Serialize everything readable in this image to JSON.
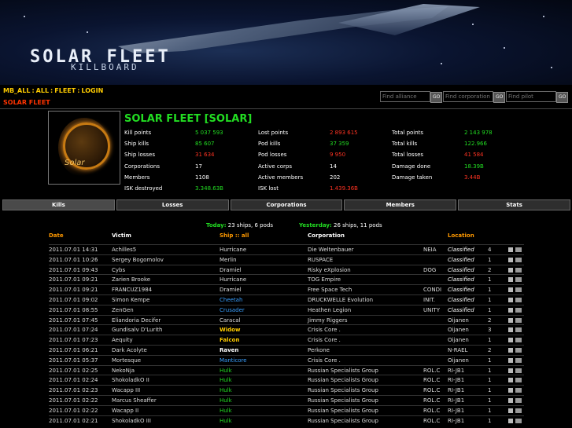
{
  "banner": {
    "title": "SOLAR FLEET",
    "subtitle": "KILLBOARD"
  },
  "nav": {
    "crumbs": [
      "MB_ALL",
      "ALL",
      "FLEET",
      "LOGIN"
    ],
    "current": "SOLAR FLEET",
    "search": [
      {
        "placeholder": "Find alliance",
        "button": "GO"
      },
      {
        "placeholder": "Find corporation",
        "button": "GO"
      },
      {
        "placeholder": "Find pilot",
        "button": "GO"
      }
    ]
  },
  "corp": {
    "emblem_text": "Solar",
    "name": "SOLAR FLEET [SOLAR]",
    "stats_col1": [
      {
        "label": "Kill points",
        "value": "5 037 593",
        "color": "green"
      },
      {
        "label": "Ship kills",
        "value": "85 607",
        "color": "green"
      },
      {
        "label": "Ship losses",
        "value": "31 634",
        "color": "red"
      },
      {
        "label": "Corporations",
        "value": "17",
        "color": "white"
      },
      {
        "label": "Members",
        "value": "1108",
        "color": "white"
      },
      {
        "label": "ISK destroyed",
        "value": "3.348.63B",
        "color": "green"
      }
    ],
    "stats_col2": [
      {
        "label": "Lost points",
        "value": "2 893 615",
        "color": "red"
      },
      {
        "label": "Pod kills",
        "value": "37 359",
        "color": "green"
      },
      {
        "label": "Pod losses",
        "value": "9 950",
        "color": "red"
      },
      {
        "label": "Active corps",
        "value": "14",
        "color": "white"
      },
      {
        "label": "Active members",
        "value": "202",
        "color": "white"
      },
      {
        "label": "ISK lost",
        "value": "1.439.36B",
        "color": "red"
      }
    ],
    "stats_col3": [
      {
        "label": "Total points",
        "value": "2 143 978",
        "color": "green"
      },
      {
        "label": "Total kills",
        "value": "122.966",
        "color": "green"
      },
      {
        "label": "Total losses",
        "value": "41 584",
        "color": "red"
      },
      {
        "label": "Damage done",
        "value": "18.39B",
        "color": "green"
      },
      {
        "label": "Damage taken",
        "value": "3.44B",
        "color": "red"
      }
    ]
  },
  "tabs": [
    "Kills",
    "Losses",
    "Corporations",
    "Members",
    "Stats"
  ],
  "summary": {
    "today_label": "Today:",
    "today_value": "23 ships, 6 pods",
    "yesterday_label": "Yesterday:",
    "yesterday_value": "26 ships, 11 pods"
  },
  "table": {
    "headers": [
      "Date",
      "Victim",
      "Ship :: all",
      "Corporation",
      "Location"
    ],
    "rows": [
      {
        "date": "2011.07.01 14:31",
        "victim": "Achilles5",
        "ship": "Hurricane",
        "shipStyle": "",
        "corp": "Die Weltenbauer",
        "tick": "NEIA",
        "loc": "Classified",
        "sec": "4"
      },
      {
        "date": "2011.07.01 10:26",
        "victim": "Sergey Bogomolov",
        "ship": "Merlin",
        "shipStyle": "",
        "corp": "RUSPACE",
        "tick": "",
        "loc": "Classified",
        "sec": "1"
      },
      {
        "date": "2011.07.01 09:43",
        "victim": "Cybs",
        "ship": "Dramiel",
        "shipStyle": "",
        "corp": "Risky eXplosion",
        "tick": "DOG",
        "loc": "Classified",
        "sec": "2"
      },
      {
        "date": "2011.07.01 09:21",
        "victim": "Zarien Brooke",
        "ship": "Hurricane",
        "shipStyle": "",
        "corp": "TOG Empire",
        "tick": "",
        "loc": "Classified",
        "sec": "1"
      },
      {
        "date": "2011.07.01 09:21",
        "victim": "FRANCUZ1984",
        "ship": "Dramiel",
        "shipStyle": "",
        "corp": "Free Space Tech",
        "tick": "CONDI",
        "loc": "Classified",
        "sec": "1"
      },
      {
        "date": "2011.07.01 09:02",
        "victim": "Simon Kempe",
        "ship": "Cheetah",
        "shipStyle": "blue",
        "corp": "DRUCKWELLE Evolution",
        "tick": "INIT.",
        "loc": "Classified",
        "sec": "1"
      },
      {
        "date": "2011.07.01 08:55",
        "victim": "ZenGen",
        "ship": "Crusader",
        "shipStyle": "blue",
        "corp": "Heathen Legion",
        "tick": "UNITY",
        "loc": "Classified",
        "sec": "1"
      },
      {
        "date": "2011.07.01 07:45",
        "victim": "Eliandoria Decifer",
        "ship": "Caracal",
        "shipStyle": "",
        "corp": "Jimmy Riggers",
        "tick": "",
        "loc": "Oijanen",
        "sec": "2"
      },
      {
        "date": "2011.07.01 07:24",
        "victim": "Gundisalv D'Lurith",
        "ship": "Widow",
        "shipStyle": "yel",
        "corp": "Crisis Core .",
        "tick": "",
        "loc": "Oijanen",
        "sec": "3"
      },
      {
        "date": "2011.07.01 07:23",
        "victim": "Aequity",
        "ship": "Falcon",
        "shipStyle": "yel",
        "corp": "Crisis Core .",
        "tick": "",
        "loc": "Oijanen",
        "sec": "1"
      },
      {
        "date": "2011.07.01 06:21",
        "victim": "Dark Acolyte",
        "ship": "Raven",
        "shipStyle": "bold",
        "corp": "Perkone",
        "tick": "",
        "loc": "N-RAEL",
        "sec": "2"
      },
      {
        "date": "2011.07.01 05:37",
        "victim": "Mortesque",
        "ship": "Manticore",
        "shipStyle": "blue",
        "corp": "Crisis Core .",
        "tick": "",
        "loc": "Oijanen",
        "sec": "1"
      },
      {
        "date": "2011.07.01 02:25",
        "victim": "NekoNja",
        "ship": "Hulk",
        "shipStyle": "grn",
        "corp": "Russian Specialists Group",
        "tick": "ROL.C",
        "loc": "RI-JB1",
        "sec": "1"
      },
      {
        "date": "2011.07.01 02:24",
        "victim": "ShokoladkO II",
        "ship": "Hulk",
        "shipStyle": "grn",
        "corp": "Russian Specialists Group",
        "tick": "ROL.C",
        "loc": "RI-JB1",
        "sec": "1"
      },
      {
        "date": "2011.07.01 02:23",
        "victim": "Wacapp III",
        "ship": "Hulk",
        "shipStyle": "grn",
        "corp": "Russian Specialists Group",
        "tick": "ROL.C",
        "loc": "RI-JB1",
        "sec": "1"
      },
      {
        "date": "2011.07.01 02:22",
        "victim": "Marcus Sheaffer",
        "ship": "Hulk",
        "shipStyle": "grn",
        "corp": "Russian Specialists Group",
        "tick": "ROL.C",
        "loc": "RI-JB1",
        "sec": "1"
      },
      {
        "date": "2011.07.01 02:22",
        "victim": "Wacapp II",
        "ship": "Hulk",
        "shipStyle": "grn",
        "corp": "Russian Specialists Group",
        "tick": "ROL.C",
        "loc": "RI-JB1",
        "sec": "1"
      },
      {
        "date": "2011.07.01 02:21",
        "victim": "ShokoladkO III",
        "ship": "Hulk",
        "shipStyle": "grn",
        "corp": "Russian Specialists Group",
        "tick": "ROL.C",
        "loc": "RI-JB1",
        "sec": "1"
      }
    ]
  }
}
